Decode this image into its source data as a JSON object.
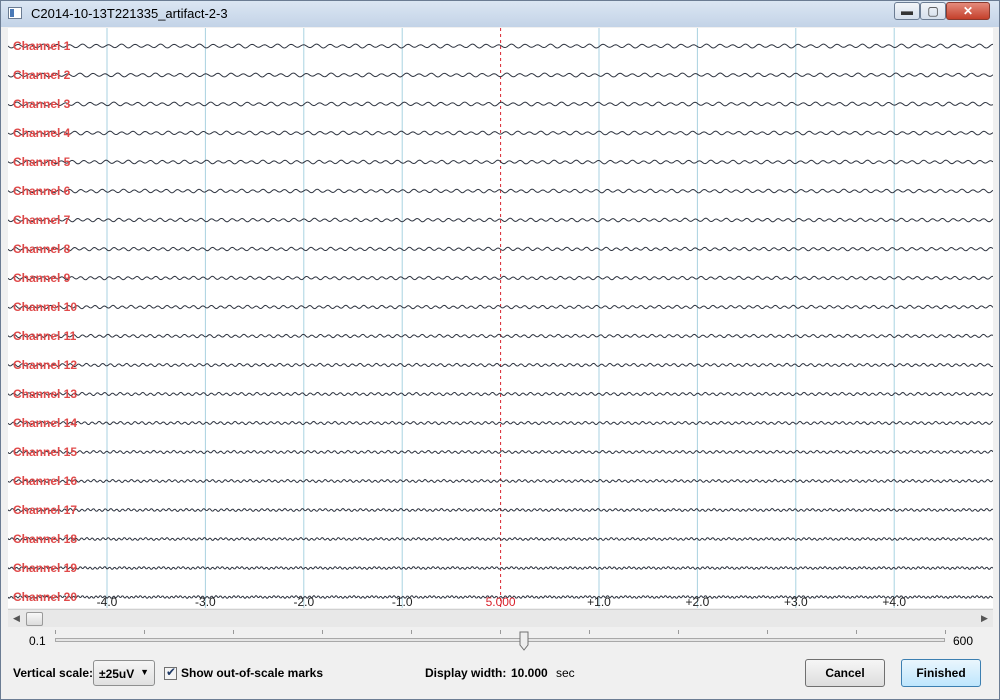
{
  "window": {
    "title": "C2014-10-13T221335_artifact-2-3",
    "min_glyph": "▬",
    "max_glyph": "▢",
    "close_glyph": "✕"
  },
  "plot": {
    "channels": [
      "Channel 1",
      "Channel 2",
      "Channel 3",
      "Channel 4",
      "Channel 5",
      "Channel 6",
      "Channel 7",
      "Channel 8",
      "Channel 9",
      "Channel 10",
      "Channel 11",
      "Channel 12",
      "Channel 13",
      "Channel 14",
      "Channel 15",
      "Channel 16",
      "Channel 17",
      "Channel 18",
      "Channel 19",
      "Channel 20"
    ],
    "time_ticks": [
      "-4.0",
      "-3.0",
      "-2.0",
      "-1.0",
      "5.000",
      "+1.0",
      "+2.0",
      "+3.0",
      "+4.0"
    ],
    "center_index": 4,
    "colors": {
      "channel_label": "#e04a4a",
      "grid": "#a9d2e0",
      "cursor": "#d9232d",
      "trace": "#2e3440"
    }
  },
  "scrollbar": {
    "position": 0.0
  },
  "zoom": {
    "min_label": "0.1",
    "max_label": "600",
    "slider_fraction": 0.53
  },
  "controls": {
    "vertical_scale_label": "Vertical scale:",
    "vertical_scale_value": "±25uV",
    "show_marks_label": "Show out-of-scale marks",
    "show_marks_checked": true,
    "display_width_label": "Display width:",
    "display_width_value": "10.000",
    "display_width_unit": "sec",
    "cancel_label": "Cancel",
    "finished_label": "Finished"
  }
}
